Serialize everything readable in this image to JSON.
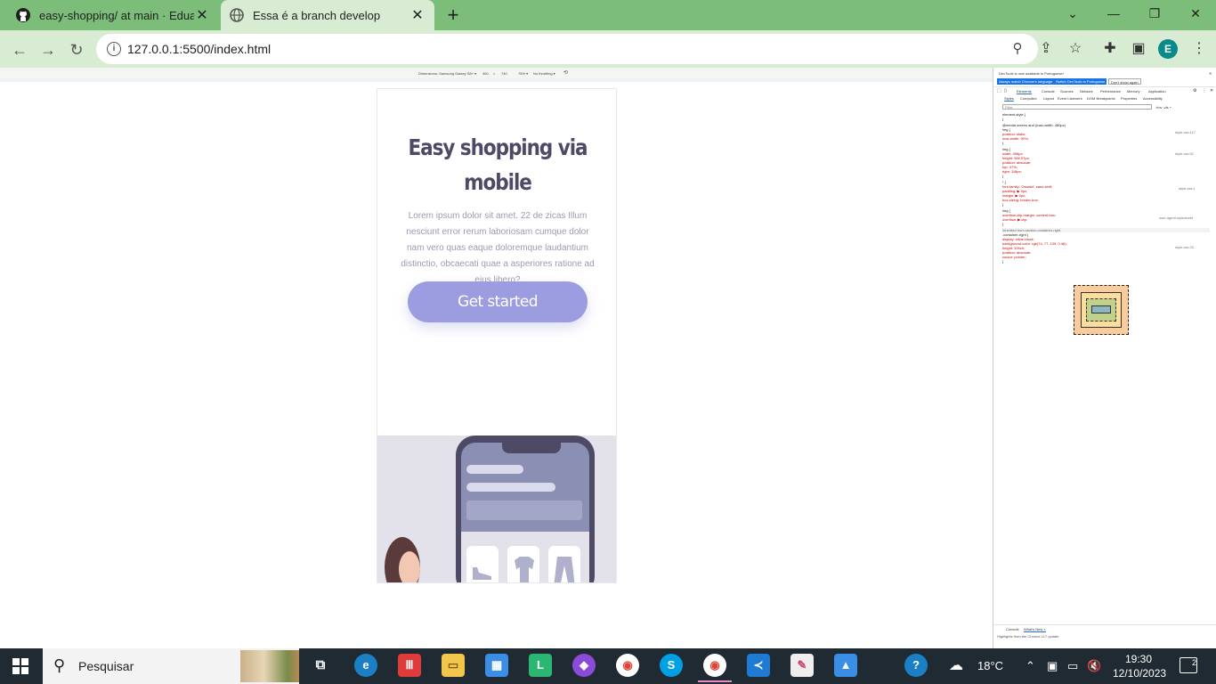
{
  "browser": {
    "tabs": [
      {
        "title": "easy-shopping/ at main · Eduard",
        "icon": "github-icon",
        "active": false
      },
      {
        "title": "Essa é a branch develop",
        "icon": "globe-icon",
        "active": true
      }
    ],
    "new_tab_label": "+",
    "url": "127.0.0.1:5500/index.html",
    "profile_initial": "E"
  },
  "device_toolbar": {
    "dimensions": "Dimensions: Samsung Galaxy S8+ ▾",
    "width": "360",
    "x": "×",
    "height": "740",
    "zoom": "75% ▾",
    "throttling": "No throttling ▾"
  },
  "page": {
    "title": "Easy shopping via mobile",
    "text": "Lorem ipsum dolor sit amet. 22 de zicas Illum nesciunt error rerum laboriosam cumque dolor nam vero quas eaque doloremque laudantium distinctio, obcaecati quae a asperiores ratione ad eius libero?",
    "cta_label": "Get started",
    "colors": {
      "title": "#4e4a66",
      "text": "#9d99b2",
      "button": "#9c9de0",
      "illustration_bg": "#e3e2ea"
    }
  },
  "devtools": {
    "banner": "DevTools is now available in Portuguese!",
    "btn_always_match": "Always match Chrome's language",
    "btn_switch": "Switch DevTools to Portuguese",
    "btn_dont_show": "Don't show again",
    "tabs": [
      "Elements",
      "Console",
      "Sources",
      "Network",
      "Performance",
      "Memory",
      "Application"
    ],
    "subtabs": [
      "Styles",
      "Computed",
      "Layout",
      "Event Listeners",
      "DOM Breakpoints",
      "Properties",
      "Accessibility"
    ],
    "filter_placeholder": "Filter",
    "filter_tools": ":hov .cls +",
    "rules": [
      "element.style {",
      "}",
      "@media screen and (max-width: 480px)",
      "img {",
      "  position: static;",
      "  max-width: 90%;",
      "}",
      "img {",
      "  width: 496px;",
      "  height: 946.97px;",
      "  position: absolute;",
      "  top: 37%;",
      "  right: 118px;",
      "}",
      "* {",
      "  font-family: 'Oswald', sans-serif;",
      "  padding: ▶ 0px;",
      "  margin: ▶ 0px;",
      "  box-sizing: border-box;",
      "}",
      "img {",
      "  overflow-clip-margin: content-box;",
      "  overflow: ▶ clip;",
      "}",
      "Inherited from section.container-right",
      ".container-right {",
      "  display: inline-block;",
      "  background-color: rgb(74, 77, 139, 0.46);",
      "  height: 100vh;",
      "  position: absolute;",
      "  cursor: pointer;",
      "}"
    ],
    "sources": [
      "style.css:117",
      "style.css:52",
      "style.css:1",
      "user agent stylesheet",
      "style.css:23"
    ],
    "drawer_tabs": [
      "Console",
      "What's New ×"
    ],
    "drawer_text": "Highlights from the Chrome 117 update"
  },
  "taskbar": {
    "search_label": "Pesquisar",
    "weather": "18°C",
    "time": "19:30",
    "date": "12/10/2023",
    "notifications": "2"
  }
}
